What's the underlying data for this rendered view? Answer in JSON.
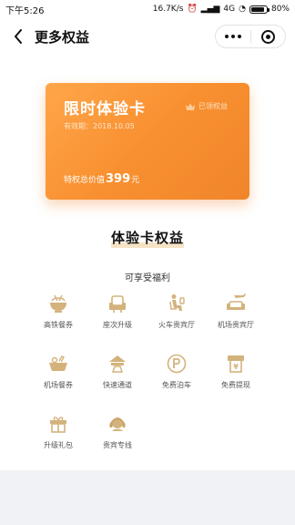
{
  "status_bar": {
    "time": "下午5:26",
    "network_speed": "16.7K/s",
    "signal": "4G",
    "battery": "80%",
    "battery_level": 0.8
  },
  "nav": {
    "title": "更多权益"
  },
  "card": {
    "title": "限时体验卡",
    "validity": "有效期：2018.10.05",
    "badge": "已领权益",
    "total_prefix": "特权总价值",
    "total_value": "399",
    "total_unit": "元"
  },
  "section": {
    "title": "体验卡权益",
    "subtitle": "可享受福利"
  },
  "benefits": [
    {
      "label": "高铁餐券",
      "icon": "bowl-icon"
    },
    {
      "label": "座次升级",
      "icon": "seat-icon"
    },
    {
      "label": "火车贵宾厅",
      "icon": "lounge-person-icon"
    },
    {
      "label": "机场贵宾厅",
      "icon": "airport-lounge-icon"
    },
    {
      "label": "机场餐券",
      "icon": "food-basket-icon"
    },
    {
      "label": "快速通道",
      "icon": "fast-lane-icon"
    },
    {
      "label": "免费泊车",
      "icon": "parking-icon"
    },
    {
      "label": "免费提现",
      "icon": "withdraw-icon"
    },
    {
      "label": "升级礼包",
      "icon": "gift-icon"
    },
    {
      "label": "贵宾专线",
      "icon": "headset-icon"
    }
  ],
  "colors": {
    "accent_gold": "#c8a46a",
    "card_orange": "#f89030"
  }
}
